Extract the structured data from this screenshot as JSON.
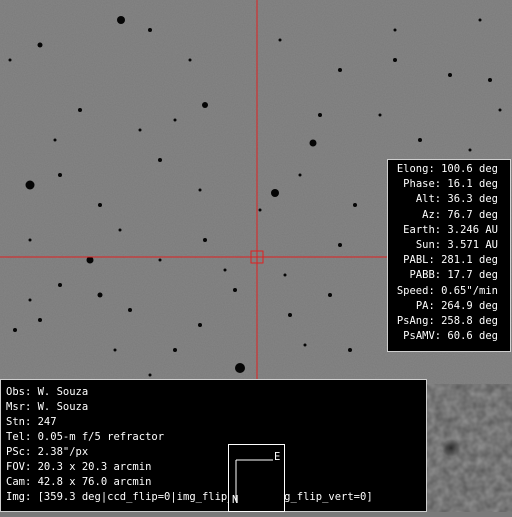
{
  "ephemeris": [
    {
      "label": "Elong",
      "value": "100.6 deg"
    },
    {
      "label": "Phase",
      "value": "16.1 deg"
    },
    {
      "label": "Alt",
      "value": "36.3 deg"
    },
    {
      "label": "Az",
      "value": "76.7 deg"
    },
    {
      "label": "Earth",
      "value": "3.246 AU"
    },
    {
      "label": "Sun",
      "value": "3.571 AU"
    },
    {
      "label": "PABL",
      "value": "281.1 deg"
    },
    {
      "label": "PABB",
      "value": "17.7 deg"
    },
    {
      "label": "Speed",
      "value": "0.65\"/min"
    },
    {
      "label": "PA",
      "value": "264.9 deg"
    },
    {
      "label": "PsAng",
      "value": "258.8 deg"
    },
    {
      "label": "PsAMV",
      "value": "60.6 deg"
    }
  ],
  "observation": [
    {
      "label": "Obs",
      "value": "W. Souza"
    },
    {
      "label": "Msr",
      "value": "W. Souza"
    },
    {
      "label": "Stn",
      "value": "247"
    },
    {
      "label": "Tel",
      "value": "0.05-m f/5 refractor"
    },
    {
      "label": "PSc",
      "value": "2.38\"/px"
    },
    {
      "label": "FOV",
      "value": "20.3 x 20.3 arcmin"
    },
    {
      "label": "Cam",
      "value": "42.8 x 76.0 arcmin"
    },
    {
      "label": "Img",
      "value": "[359.3 deg|ccd_flip=0|img_flip_hor=0|img_flip_vert=0]"
    }
  ],
  "orientation": {
    "east": "E",
    "north": "N"
  },
  "colors": {
    "crosshair": "#e02020",
    "sky_background": "#7a7a7a",
    "panel_background": "#000000",
    "panel_text": "#ffffff"
  }
}
